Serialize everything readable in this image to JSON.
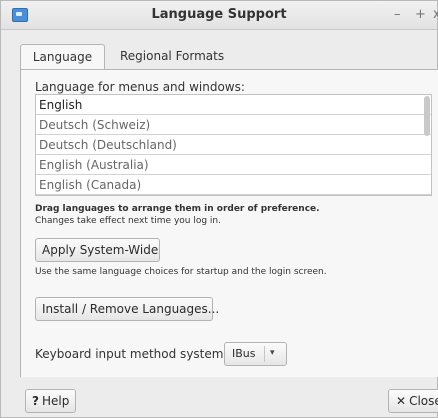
{
  "window": {
    "title": "Language Support",
    "controls": {
      "minimize": "–",
      "maximize": "+",
      "close": "x"
    }
  },
  "tabs": [
    {
      "label": "Language"
    },
    {
      "label": "Regional Formats"
    }
  ],
  "language_section": {
    "label": "Language for menus and windows:",
    "languages": [
      "English",
      "Deutsch (Schweiz)",
      "Deutsch (Deutschland)",
      "English (Australia)",
      "English (Canada)"
    ],
    "hint_bold": "Drag languages to arrange them in order of preference.",
    "hint": "Changes take effect next time you log in."
  },
  "buttons": {
    "apply": "Apply System-Wide",
    "startup_note": "Use the same language choices for startup and the login screen.",
    "install": "Install / Remove Languages...",
    "help": "Help",
    "close": "Close"
  },
  "keyboard": {
    "label": "Keyboard input method system:",
    "selected": "IBus"
  },
  "icons": {
    "app": "language-support-icon",
    "help": "question-icon",
    "close": "close-icon",
    "combo": "dropdown-arrow-icon"
  }
}
